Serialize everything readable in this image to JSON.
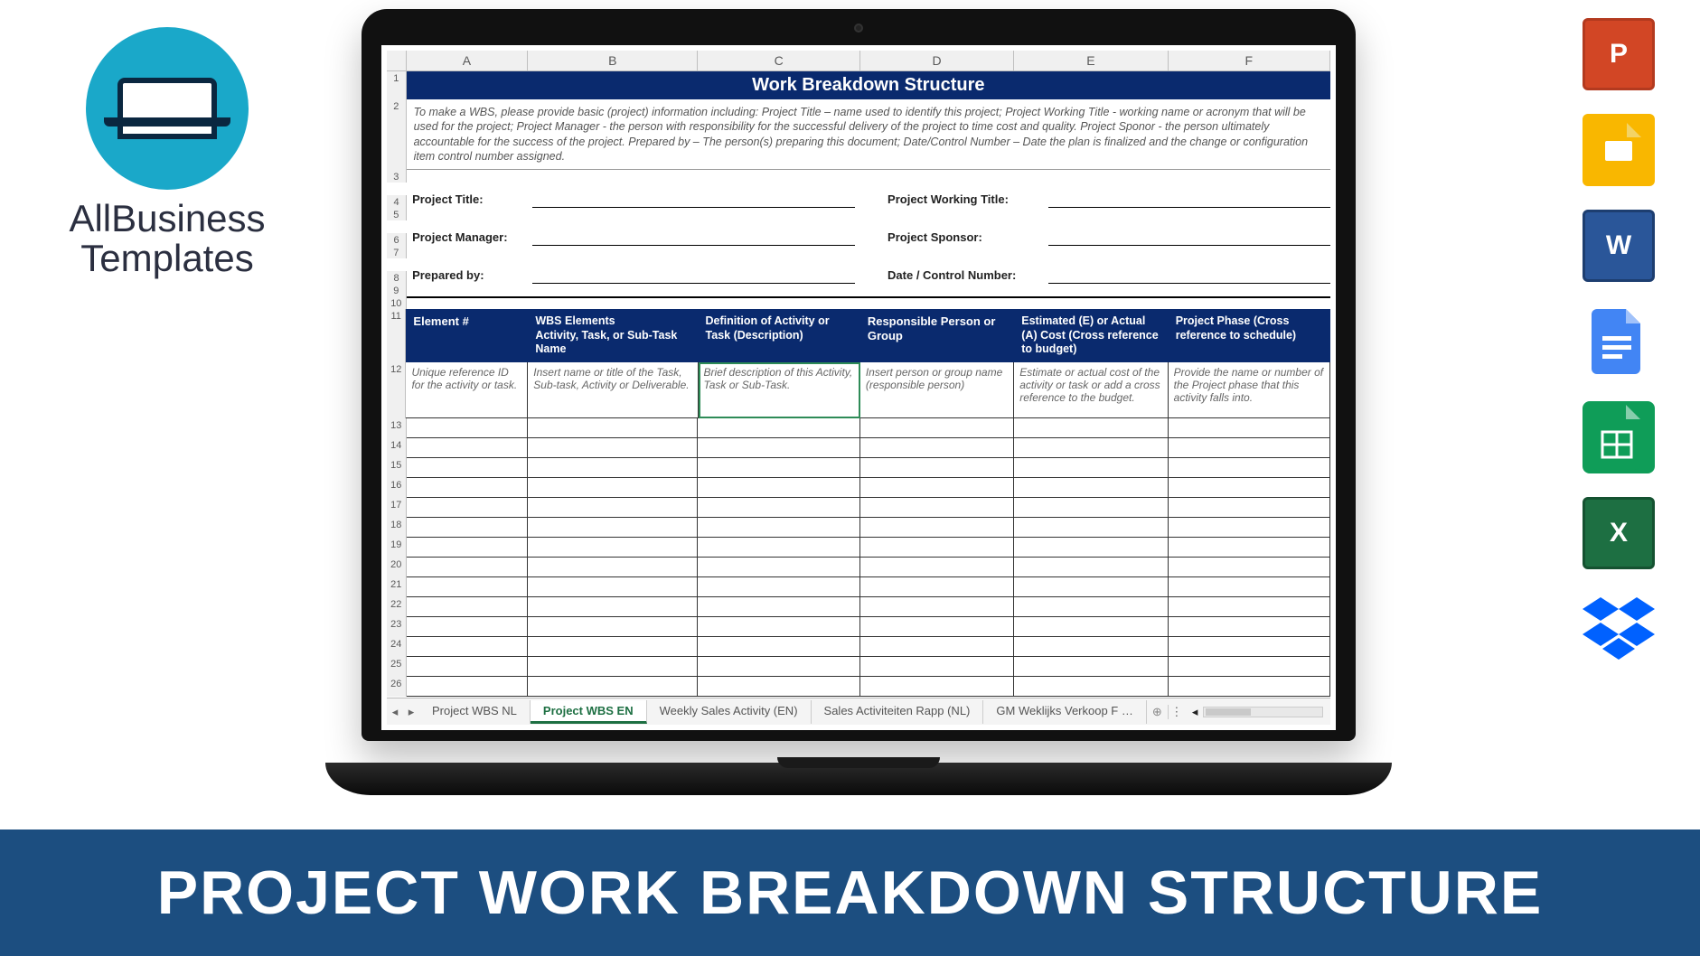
{
  "brand": {
    "line1": "AllBusiness",
    "line2": "Templates"
  },
  "icons": [
    "ppt-icon",
    "slides-icon",
    "word-icon",
    "gdocs-icon",
    "gsheets-icon",
    "excel-icon",
    "dropbox-icon"
  ],
  "banner": "PROJECT WORK BREAKDOWN STRUCTURE",
  "spreadsheet": {
    "columns": [
      "A",
      "B",
      "C",
      "D",
      "E",
      "F"
    ],
    "title": "Work Breakdown Structure",
    "instructions": "To make a WBS, please provide basic (project) information including: Project Title – name used to identify this project; Project Working Title - working name or acronym that will be used for the project; Project Manager - the person with responsibility for the successful delivery of the project to time cost and quality. Project Sponor - the person ultimately accountable for the success of the project. Prepared by – The person(s) preparing this document; Date/Control Number – Date the plan is finalized and the change or configuration item control number assigned.",
    "meta": {
      "projectTitle": "Project Title:",
      "projectWorkingTitle": "Project Working Title:",
      "projectManager": "Project Manager:",
      "projectSponsor": "Project Sponsor:",
      "preparedBy": "Prepared by:",
      "dateControl": "Date / Control Number:"
    },
    "headers": {
      "A": "Element #",
      "B": "WBS Elements\nActivity, Task, or Sub-Task Name",
      "C": "Definition of Activity or Task (Description)",
      "D": "Responsible Person or Group",
      "E": "Estimated (E) or Actual (A) Cost (Cross reference to budget)",
      "F": "Project Phase (Cross reference to schedule)"
    },
    "descriptions": {
      "A": "Unique reference ID for the activity or task.",
      "B": "Insert name or title of the Task, Sub-task, Activity or Deliverable.",
      "C": "Brief description of this Activity, Task or Sub-Task.",
      "D": "Insert person or group name (responsible person)",
      "E": "Estimate or actual cost of the activity or task or add a cross reference to the budget.",
      "F": "Provide the name or number of the Project phase that this activity falls into."
    },
    "rowNumbers": [
      1,
      2,
      3,
      4,
      5,
      6,
      7,
      8,
      9,
      10,
      11,
      12,
      13,
      14,
      15,
      16,
      17,
      18,
      19,
      20,
      21,
      22,
      23,
      24,
      25,
      26
    ],
    "emptyRows": 14,
    "tabs": {
      "list": [
        "Project WBS NL",
        "Project WBS EN",
        "Weekly Sales Activity (EN)",
        "Sales Activiteiten Rapp (NL)",
        "GM Weklijks Verkoop F …"
      ],
      "active": 1,
      "add": "⊕"
    }
  }
}
